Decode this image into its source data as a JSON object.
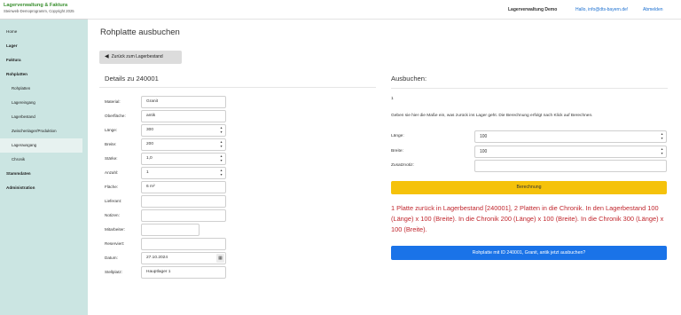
{
  "brand": {
    "title": "Lagerverwaltung & Faktura",
    "subtitle": "Steinweb-Demoprogramm, Copyright 2025"
  },
  "sidebar": {
    "items": [
      {
        "label": "Home"
      },
      {
        "label": "Lager"
      },
      {
        "label": "Faktura"
      },
      {
        "label": "Rohplatten"
      },
      {
        "label": "Rohplatten"
      },
      {
        "label": "Lagereingang"
      },
      {
        "label": "Lagerbestand"
      },
      {
        "label": "Zwischenlager/Produktion"
      },
      {
        "label": "Lagerausgang"
      },
      {
        "label": "Chronik"
      },
      {
        "label": "Stammdaten"
      },
      {
        "label": "Administration"
      }
    ]
  },
  "header": {
    "title": "Lagerverwaltung Demo",
    "user": "Hallo, info@dts-bayern.de!",
    "logout": "Abmelden"
  },
  "page": {
    "title": "Rohplatte ausbuchen",
    "back_label": "Zurück zum Lagerbestand"
  },
  "details": {
    "heading": "Details zu 240001",
    "fields": [
      {
        "label": "Material:",
        "value": "Granit"
      },
      {
        "label": "Oberfläche:",
        "value": "antik"
      },
      {
        "label": "Länge:",
        "value": "300"
      },
      {
        "label": "Breite:",
        "value": "200"
      },
      {
        "label": "Stärke:",
        "value": "1,0"
      },
      {
        "label": "Anzahl:",
        "value": "1"
      },
      {
        "label": "Fläche:",
        "value": "6 m²"
      },
      {
        "label": "Lieferant:",
        "value": ""
      },
      {
        "label": "Notizen:",
        "value": ""
      },
      {
        "label": "Mitarbeiter:",
        "value": ""
      },
      {
        "label": "Reserviert:",
        "value": ""
      },
      {
        "label": "Datum:",
        "value": "27.10.2024"
      },
      {
        "label": "Stellplatz:",
        "value": "Hauptlager 1"
      }
    ]
  },
  "ausbuchen": {
    "heading": "Ausbuchen:",
    "count": "1",
    "instructions": "Geben sie hier die Maße ein, was zurück ins Lager geht. Die Berechnung erfolgt nach Klick auf Berechnen.",
    "laenge_label": "Länge:",
    "laenge_value": "100",
    "breite_label": "Breite:",
    "breite_value": "100",
    "zusatz_label": "Zusatznotiz:",
    "zusatz_value": "",
    "calc_button": "Berechnung",
    "result": "1 Platte zurück in Lagerbestand [240001], 2 Platten in die Chronik. In den Lagerbestand 100 (Länge) x 100 (Breite). In die Chronik 200 (Länge) x 100 (Breite). In die Chronik 300 (Länge) x 100 (Breite).",
    "confirm_button": "Rohplatte mit ID 240001, Granit, antik jetzt ausbuchen?"
  },
  "icons": {
    "back": "caret-left-icon",
    "spinner": "spinner-arrows-icon",
    "calendar": "calendar-icon"
  },
  "colors": {
    "sidebar_bg": "#cbe5e2",
    "brand_green": "#3a8f2f",
    "link_blue": "#1a6fd0",
    "primary_blue": "#1a73e8",
    "warning_yellow": "#f5c20b",
    "result_red": "#c0262d"
  }
}
